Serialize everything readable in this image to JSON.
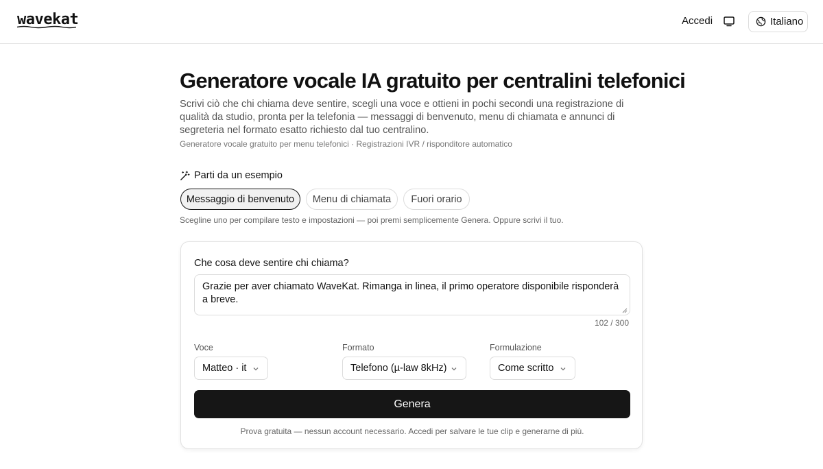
{
  "header": {
    "logo": "wavekat",
    "signin_label": "Accedi",
    "display_icon": "monitor-icon",
    "language_label": "Italiano",
    "language_icon": "globe-icon"
  },
  "hero": {
    "title": "Generatore vocale IA gratuito per centralini telefonici",
    "description": "Scrivi ciò che chi chiama deve sentire, scegli una voce e ottieni in pochi secondi una registrazione di qualità da studio, pronta per la telefonia — messaggi di benvenuto, menu di chiamata e annunci di segreteria nel formato esatto richiesto dal tuo centralino.",
    "tags": "Generatore vocale gratuito per menu telefonici · Registrazioni IVR / risponditore automatico"
  },
  "examples": {
    "heading": "Parti da un esempio",
    "icon": "magic-wand-icon",
    "chips": [
      {
        "label": "Messaggio di benvenuto",
        "active": true
      },
      {
        "label": "Menu di chiamata",
        "active": false
      },
      {
        "label": "Fuori orario",
        "active": false
      }
    ],
    "hint": "Scegline uno per compilare testo e impostazioni — poi premi semplicemente Genera. Oppure scrivi il tuo."
  },
  "form": {
    "question_label": "Che cosa deve sentire chi chiama?",
    "text_value": "Grazie per aver chiamato WaveKat. Rimanga in linea, il primo operatore disponibile risponderà a breve.",
    "counter": "102 / 300",
    "voice": {
      "label": "Voce",
      "value": "Matteo · it"
    },
    "format": {
      "label": "Formato",
      "value": "Telefono (µ-law 8kHz)"
    },
    "phrasing": {
      "label": "Formulazione",
      "value": "Come scritto"
    },
    "generate_label": "Genera",
    "footnote": "Prova gratuita — nessun account necessario. Accedi per salvare le tue clip e generarne di più."
  }
}
